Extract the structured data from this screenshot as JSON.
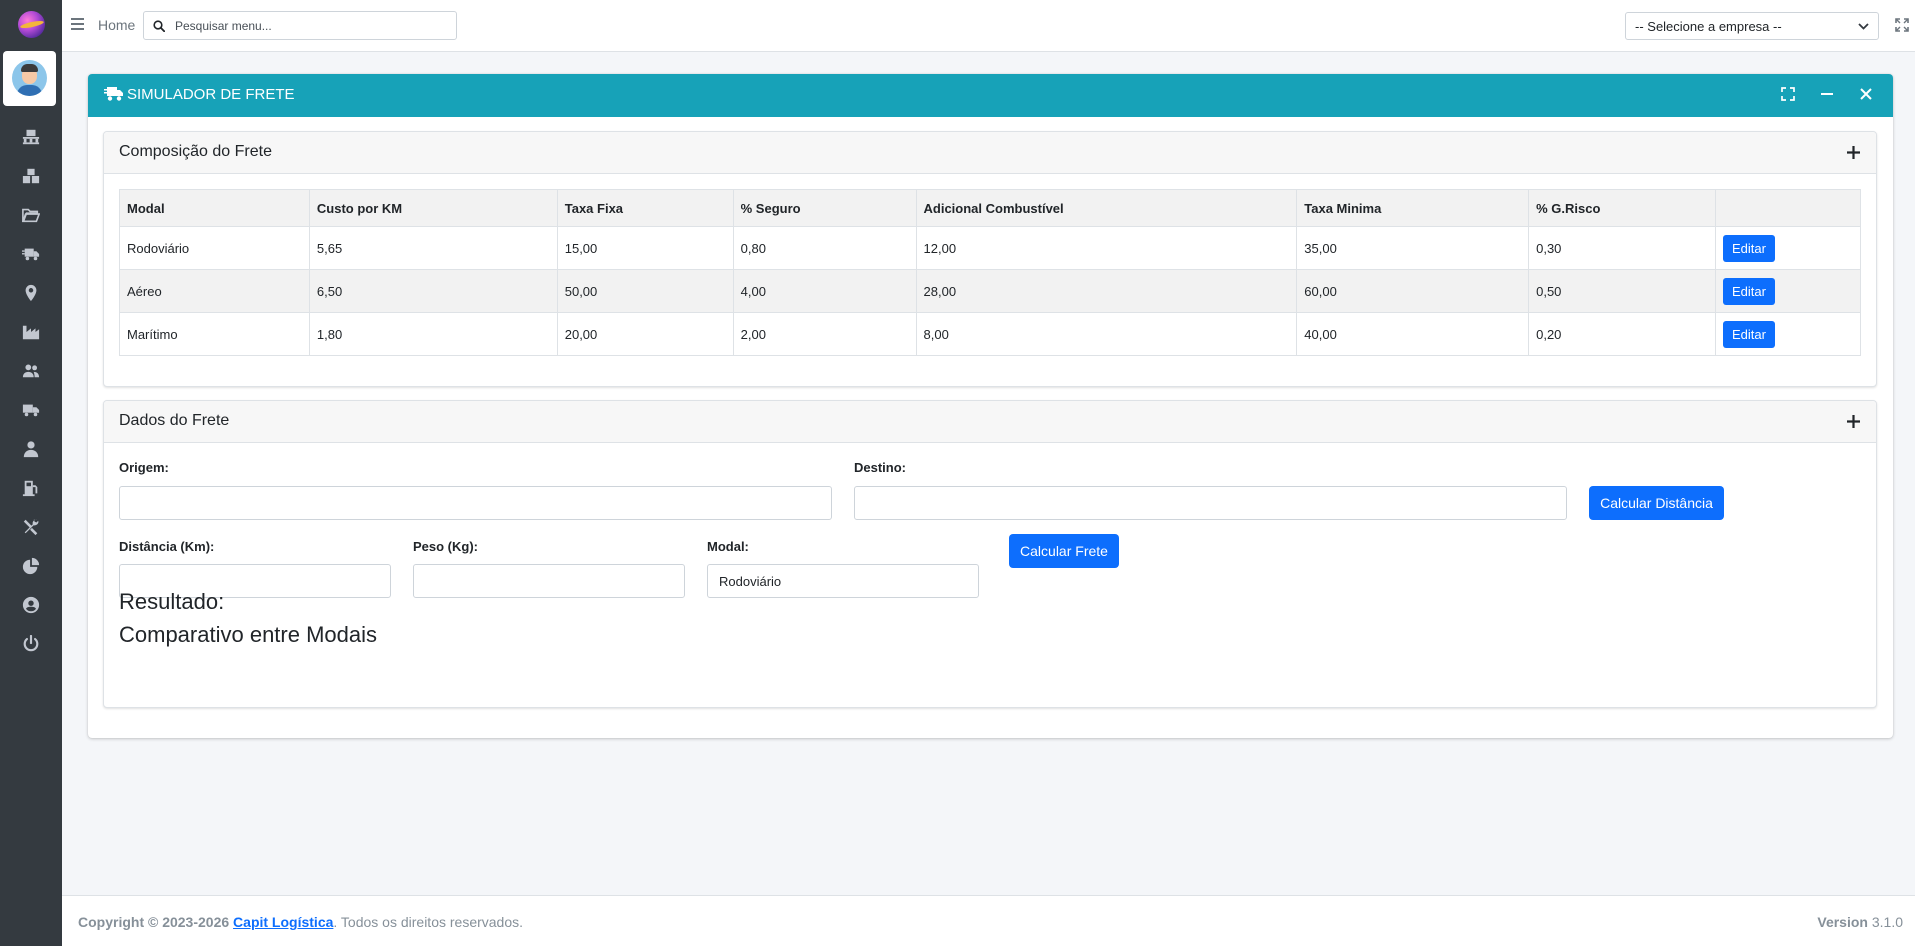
{
  "topbar": {
    "home": "Home",
    "search_placeholder": "Pesquisar menu...",
    "company_select": "-- Selecione a empresa --"
  },
  "sidebar": {
    "icons": [
      "pallet-icon",
      "boxes-icon",
      "folder-open-icon",
      "truck-fast-icon",
      "map-marker-icon",
      "industry-icon",
      "users-icon",
      "truck-icon",
      "user-tie-icon",
      "gas-pump-icon",
      "tools-icon",
      "chart-pie-icon",
      "user-circle-icon",
      "power-off-icon"
    ]
  },
  "main": {
    "title": "SIMULADOR DE FRETE"
  },
  "composition": {
    "title": "Composição do Frete",
    "headers": [
      "Modal",
      "Custo por KM",
      "Taxa Fixa",
      "% Seguro",
      "Adicional Combustível",
      "Taxa Minima",
      "% G.Risco",
      ""
    ],
    "rows": [
      {
        "modal": "Rodoviário",
        "custo_km": "5,65",
        "taxa_fixa": "15,00",
        "seguro": "0,80",
        "combustivel": "12,00",
        "taxa_minima": "35,00",
        "risco": "0,30",
        "action": "Editar"
      },
      {
        "modal": "Aéreo",
        "custo_km": "6,50",
        "taxa_fixa": "50,00",
        "seguro": "4,00",
        "combustivel": "28,00",
        "taxa_minima": "60,00",
        "risco": "0,50",
        "action": "Editar"
      },
      {
        "modal": "Marítimo",
        "custo_km": "1,80",
        "taxa_fixa": "20,00",
        "seguro": "2,00",
        "combustivel": "8,00",
        "taxa_minima": "40,00",
        "risco": "0,20",
        "action": "Editar"
      }
    ]
  },
  "freight_data": {
    "title": "Dados do Frete",
    "origem_label": "Origem:",
    "origem_value": "",
    "destino_label": "Destino:",
    "destino_value": "",
    "calc_distance_btn": "Calcular Distância",
    "distancia_label": "Distância (Km):",
    "distancia_value": "",
    "peso_label": "Peso (Kg):",
    "peso_value": "",
    "modal_label": "Modal:",
    "modal_value": "Rodoviário",
    "calc_freight_btn": "Calcular Frete",
    "result_label": "Resultado:",
    "comparison_label": "Comparativo entre Modais"
  },
  "footer": {
    "copyright": "Copyright © 2023-2026 ",
    "company": "Capit Logística",
    "rights": ". Todos os direitos reservados.",
    "version_label": "Version",
    "version_value": " 3.1.0"
  },
  "colors": {
    "sidebar": "#343a40",
    "header_accent": "#17a2b8",
    "primary": "#0d6efd"
  }
}
